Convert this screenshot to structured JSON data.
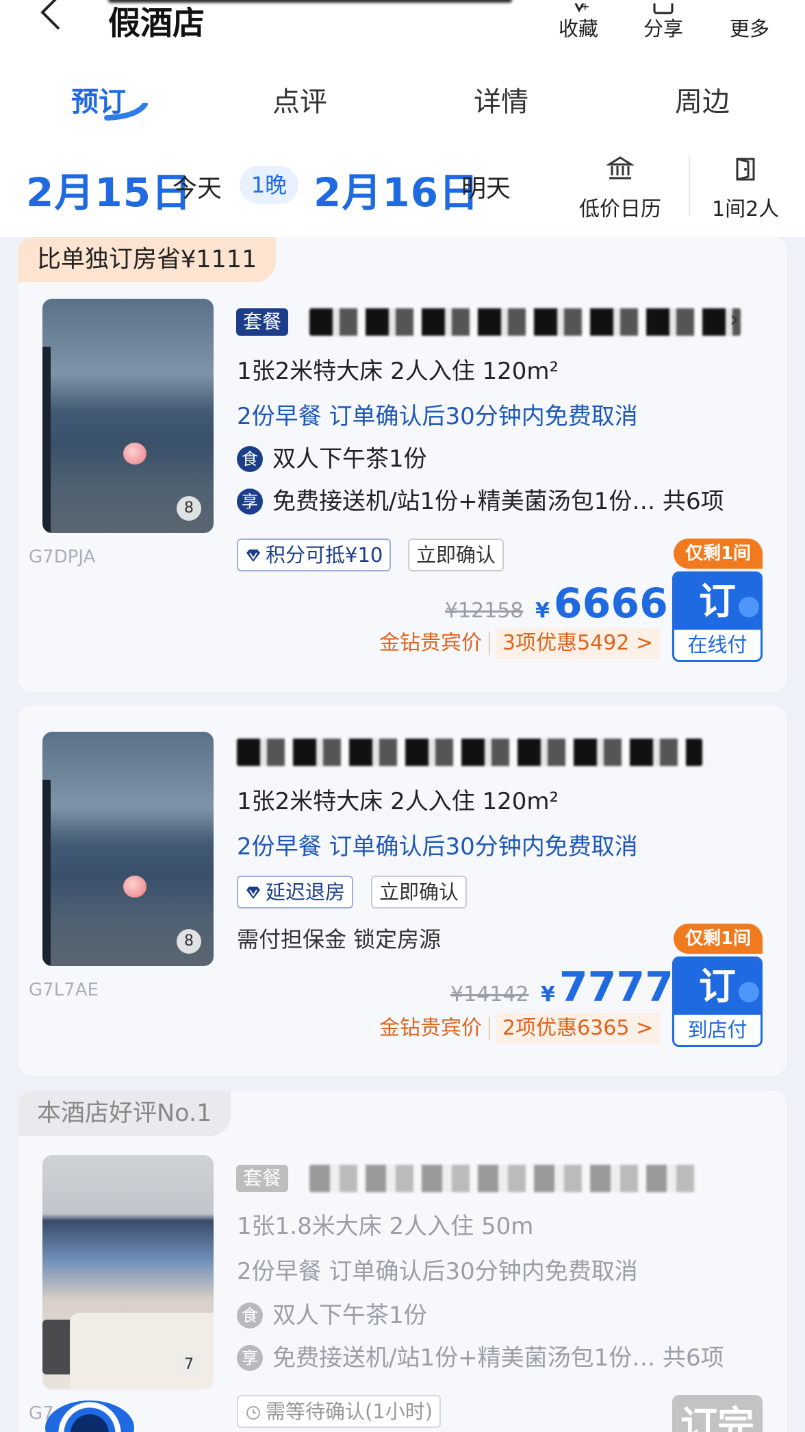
{
  "header": {
    "hotel_title": "假酒店",
    "actions": [
      {
        "label": "收藏",
        "icon": "favorite-icon"
      },
      {
        "label": "分享",
        "icon": "share-icon"
      },
      {
        "label": "更多",
        "icon": "more-icon"
      }
    ]
  },
  "tabs": [
    "预订",
    "点评",
    "详情",
    "周边"
  ],
  "dates": {
    "checkin": "2月15日",
    "checkin_sub": "今天",
    "nights": "1晚",
    "checkout": "2月16日",
    "checkout_sub": "明天",
    "calendar_label": "低价日历",
    "guests_label": "1间2人"
  },
  "rooms": [
    {
      "promo_tag": "比单独订房省¥1111",
      "package_badge": "套餐",
      "img_count": "8",
      "code": "G7DPJA",
      "bed_info": "1张2米特大床  2人入住  120m²",
      "policy": "2份早餐  订单确认后30分钟内免费取消",
      "perk1_icon": "食",
      "perk1": "双人下午茶1份",
      "perk2_icon": "享",
      "perk2": "免费接送机/站1份+精美菌汤包1份… 共6项",
      "chip1": "积分可抵¥10",
      "chip2": "立即确认",
      "scarcity": "仅剩1间",
      "book_top": "订",
      "book_bottom": "在线付",
      "orig_price": "¥12158",
      "currency": "¥",
      "price": "6666",
      "vip_label": "金钻贵宾价",
      "discount": "3项优惠5492 >"
    },
    {
      "img_count": "8",
      "code": "G7L7AE",
      "bed_info": "1张2米特大床  2人入住  120m²",
      "policy": "2份早餐  订单确认后30分钟内免费取消",
      "chip1": "延迟退房",
      "chip2": "立即确认",
      "note": "需付担保金 锁定房源",
      "scarcity": "仅剩1间",
      "book_top": "订",
      "book_bottom": "到店付",
      "orig_price": "¥14142",
      "currency": "¥",
      "price": "7777",
      "vip_label": "金钻贵宾价",
      "discount": "2项优惠6365 >"
    },
    {
      "promo_tag": "本酒店好评No.1",
      "package_badge": "套餐",
      "img_count": "7",
      "code": "G7",
      "bed_info": "1张1.8米大床  2人入住  50m",
      "policy": "2份早餐  订单确认后30分钟内免费取消",
      "perk1_icon": "食",
      "perk1": "双人下午茶1份",
      "perk2_icon": "享",
      "perk2": "免费接送机/站1份+精美菌汤包1份… 共6项",
      "chip1": "需等待确认(1小时)",
      "book_top": "订完"
    }
  ]
}
